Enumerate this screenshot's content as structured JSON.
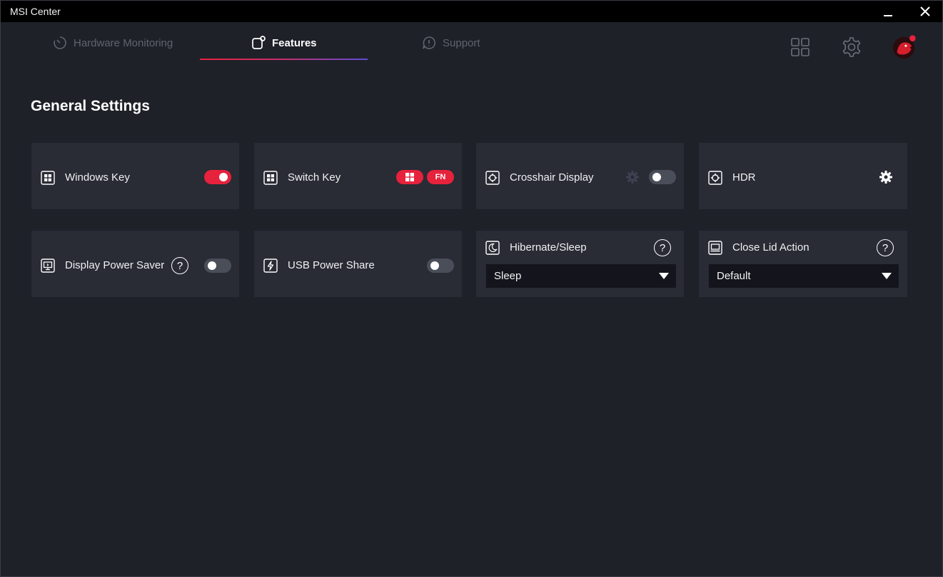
{
  "window": {
    "title": "MSI Center"
  },
  "nav": {
    "tabs": [
      {
        "label": "Hardware Monitoring",
        "active": false
      },
      {
        "label": "Features",
        "active": true
      },
      {
        "label": "Support",
        "active": false
      }
    ],
    "icons": [
      "apps-grid-icon",
      "settings-gear-icon",
      "user-avatar-icon"
    ]
  },
  "page": {
    "title": "General Settings"
  },
  "cards": {
    "windows_key": {
      "label": "Windows Key",
      "icon": "windows-icon",
      "toggle_on": true
    },
    "switch_key": {
      "label": "Switch Key",
      "icon": "windows-icon",
      "pills": [
        "windows-icon",
        "FN"
      ]
    },
    "crosshair": {
      "label": "Crosshair Display",
      "icon": "crosshair-icon",
      "toggle_on": false,
      "settings_icon": "gear-icon"
    },
    "hdr": {
      "label": "HDR",
      "icon": "hdr-icon",
      "settings_icon": "gear-icon"
    },
    "display_power_saver": {
      "label": "Display Power Saver",
      "icon": "monitor-icon",
      "help": "?",
      "toggle_on": false
    },
    "usb_power_share": {
      "label": "USB Power Share",
      "icon": "lightning-icon",
      "toggle_on": false
    },
    "hibernate_sleep": {
      "label": "Hibernate/Sleep",
      "icon": "moon-icon",
      "help": "?",
      "selected": "Sleep"
    },
    "close_lid_action": {
      "label": "Close Lid Action",
      "icon": "laptop-icon",
      "help": "?",
      "selected": "Default"
    }
  },
  "colors": {
    "accent": "#e7223c",
    "background": "#1f2129",
    "card": "#292b35",
    "dropdown": "#14151c"
  }
}
